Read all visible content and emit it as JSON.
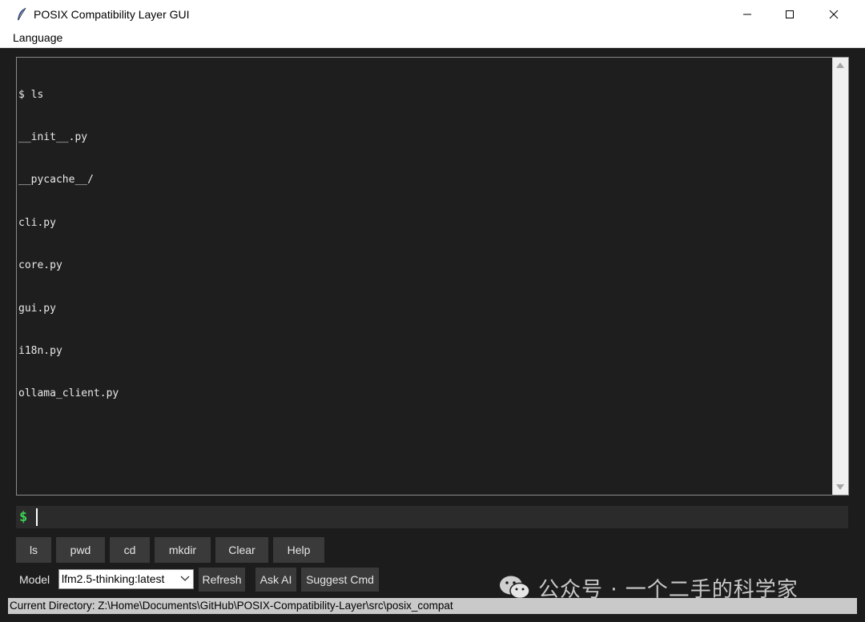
{
  "window": {
    "title": "POSIX Compatibility Layer GUI",
    "app_icon": "feather-icon",
    "controls": [
      "minimize-icon",
      "maximize-icon",
      "close-icon"
    ]
  },
  "menubar": {
    "items": [
      "Language"
    ]
  },
  "terminal": {
    "lines": [
      "$ ls",
      "__init__.py",
      "__pycache__/",
      "cli.py",
      "core.py",
      "gui.py",
      "i18n.py",
      "ollama_client.py"
    ]
  },
  "command": {
    "prompt": "$",
    "value": "",
    "placeholder": ""
  },
  "quick_buttons": [
    "ls",
    "pwd",
    "cd",
    "mkdir",
    "Clear",
    "Help"
  ],
  "model_row": {
    "label": "Model",
    "selected_model": "lfm2.5-thinking:latest",
    "buttons": [
      "Refresh",
      "Ask AI",
      "Suggest Cmd"
    ]
  },
  "watermark": {
    "text": "公众号 · 一个二手的科学家"
  },
  "status": {
    "current_directory": "Current Directory: Z:\\Home\\Documents\\GitHub\\POSIX-Compatibility-Layer\\src\\posix_compat"
  },
  "colors": {
    "background": "#1c1c1c",
    "terminal_bg": "#1e1e1e",
    "prompt_green": "#39d353",
    "button_bg": "#3a3a3a",
    "statusbar_bg": "#c9c9c9"
  }
}
